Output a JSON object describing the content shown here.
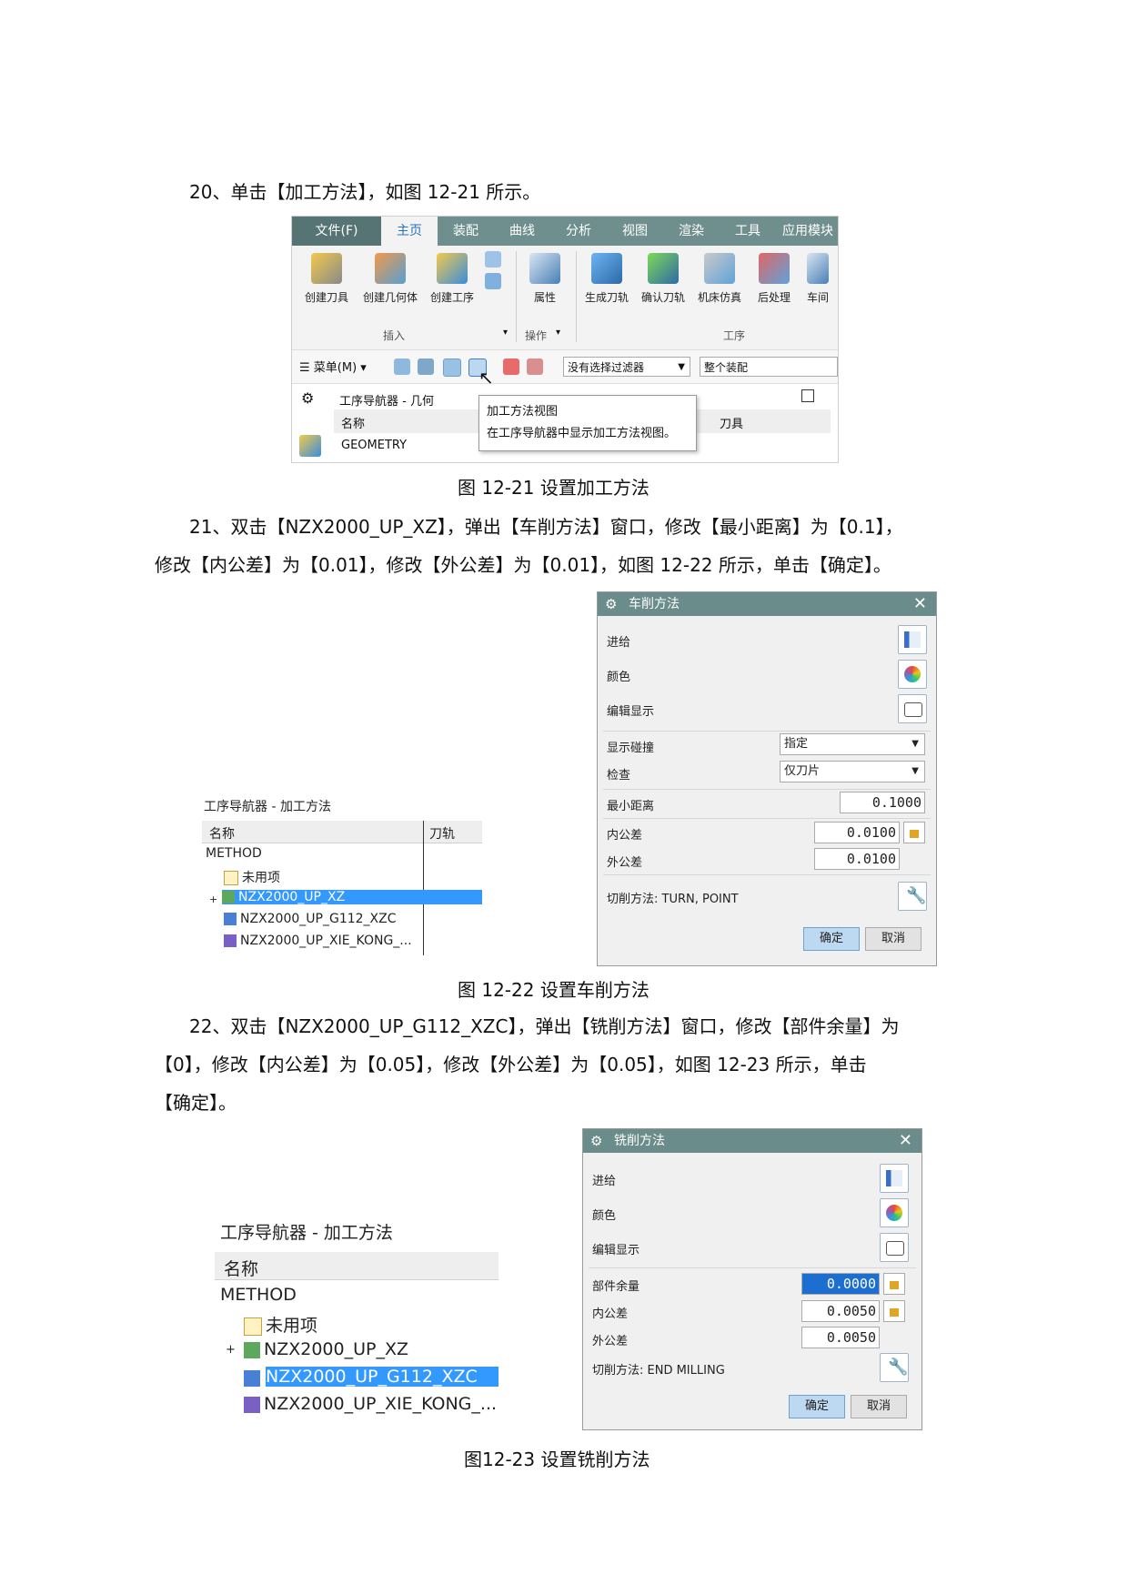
{
  "step20": "20、单击【加工方法】，如图 12-21 所示。",
  "fig21": {
    "caption": "图 12-21  设置加工方法",
    "menu_tabs": [
      "文件(F)",
      "主页",
      "装配",
      "曲线",
      "分析",
      "视图",
      "渲染",
      "工具",
      "应用模块"
    ],
    "insert_buttons": [
      "创建刀具",
      "创建几何体",
      "创建工序"
    ],
    "ops_buttons": [
      "属性"
    ],
    "proc_buttons": [
      "生成刀轨",
      "确认刀轨",
      "机床仿真",
      "后处理",
      "车间"
    ],
    "group_labels": {
      "insert": "插入",
      "ops": "操作",
      "proc": "工序"
    },
    "menu_button": "菜单(M)",
    "filter_combo": "没有选择过滤器",
    "scope_combo": "整个装配",
    "nav_title": "工序导航器 - 几何",
    "col_name": "名称",
    "col_tool": "刀具",
    "root": "GEOMETRY",
    "tooltip_title": "加工方法视图",
    "tooltip_desc": "在工序导航器中显示加工方法视图。"
  },
  "step21": {
    "line1": "21、双击【NZX2000_UP_XZ】，弹出【车削方法】窗口，修改【最小距离】为【0.1】，",
    "line2": "修改【内公差】为【0.01】，修改【外公差】为【0.01】，如图 12-22 所示，单击【确定】。"
  },
  "fig22": {
    "caption": "图 12-22  设置车削方法",
    "nav": {
      "title": "工序导航器 - 加工方法",
      "col_name": "名称",
      "col_path": "刀轨",
      "root": "METHOD",
      "items": [
        "未用项",
        "NZX2000_UP_XZ",
        "NZX2000_UP_G112_XZC",
        "NZX2000_UP_XIE_KONG_..."
      ]
    },
    "dialog": {
      "title": "车削方法",
      "feed": "进给",
      "color": "颜色",
      "edit_display": "编辑显示",
      "show_collision": "显示碰撞",
      "show_collision_value": "指定",
      "check": "检查",
      "check_value": "仅刀片",
      "min_distance": "最小距离",
      "min_distance_value": "0.1000",
      "intol": "内公差",
      "intol_value": "0.0100",
      "outtol": "外公差",
      "outtol_value": "0.0100",
      "cut_method": "切削方法: TURN, POINT",
      "ok": "确定",
      "cancel": "取消"
    }
  },
  "step22": {
    "line1": "22、双击【NZX2000_UP_G112_XZC】，弹出【铣削方法】窗口，修改【部件余量】为",
    "line2": "【0】，修改【内公差】为【0.05】，修改【外公差】为【0.05】，如图 12-23 所示，单击",
    "line3": "【确定】。"
  },
  "fig23": {
    "caption": "图12-23 设置铣削方法",
    "nav": {
      "title": "工序导航器 - 加工方法",
      "col_name": "名称",
      "root": "METHOD",
      "items": [
        "未用项",
        "NZX2000_UP_XZ",
        "NZX2000_UP_G112_XZC",
        "NZX2000_UP_XIE_KONG_..."
      ]
    },
    "dialog": {
      "title": "铣削方法",
      "feed": "进给",
      "color": "颜色",
      "edit_display": "编辑显示",
      "stock": "部件余量",
      "stock_value": "0.0000",
      "intol": "内公差",
      "intol_value": "0.0050",
      "outtol": "外公差",
      "outtol_value": "0.0050",
      "cut_method": "切削方法: END MILLING",
      "ok": "确定",
      "cancel": "取消"
    }
  }
}
